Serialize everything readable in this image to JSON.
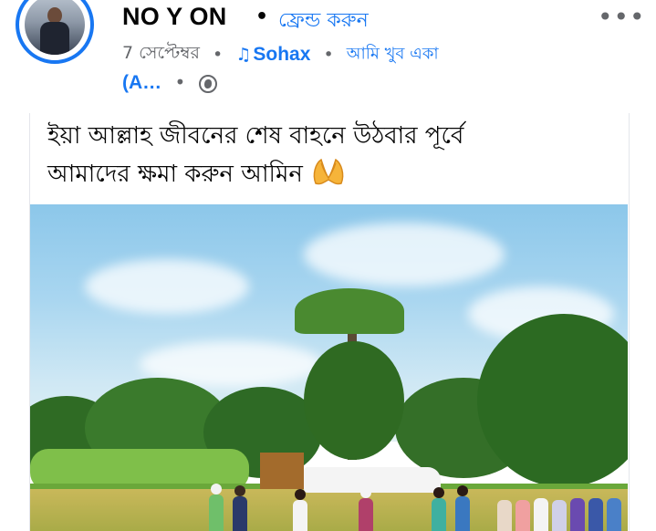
{
  "post": {
    "author_name": "NO Y ON",
    "separator": "•",
    "friend_button_label": "ফ্রেন্ড করুন",
    "more_icon": "more-options-icon",
    "date": "7 সেপ্টেম্বর",
    "music_label": "Sohax",
    "song_title": "আমি খুব একা",
    "song_title_continued": "(A…",
    "audience_icon": "globe-icon",
    "caption_line1": "ইয়া আল্লাহ জীবনের শেষ বাহনে উঠবার পূর্বে",
    "caption_line2": "আমাদের ক্ষমা করুন আমিন"
  },
  "colors": {
    "accent": "#1877f2",
    "secondary_text": "#65676b",
    "primary_text": "#050505"
  }
}
